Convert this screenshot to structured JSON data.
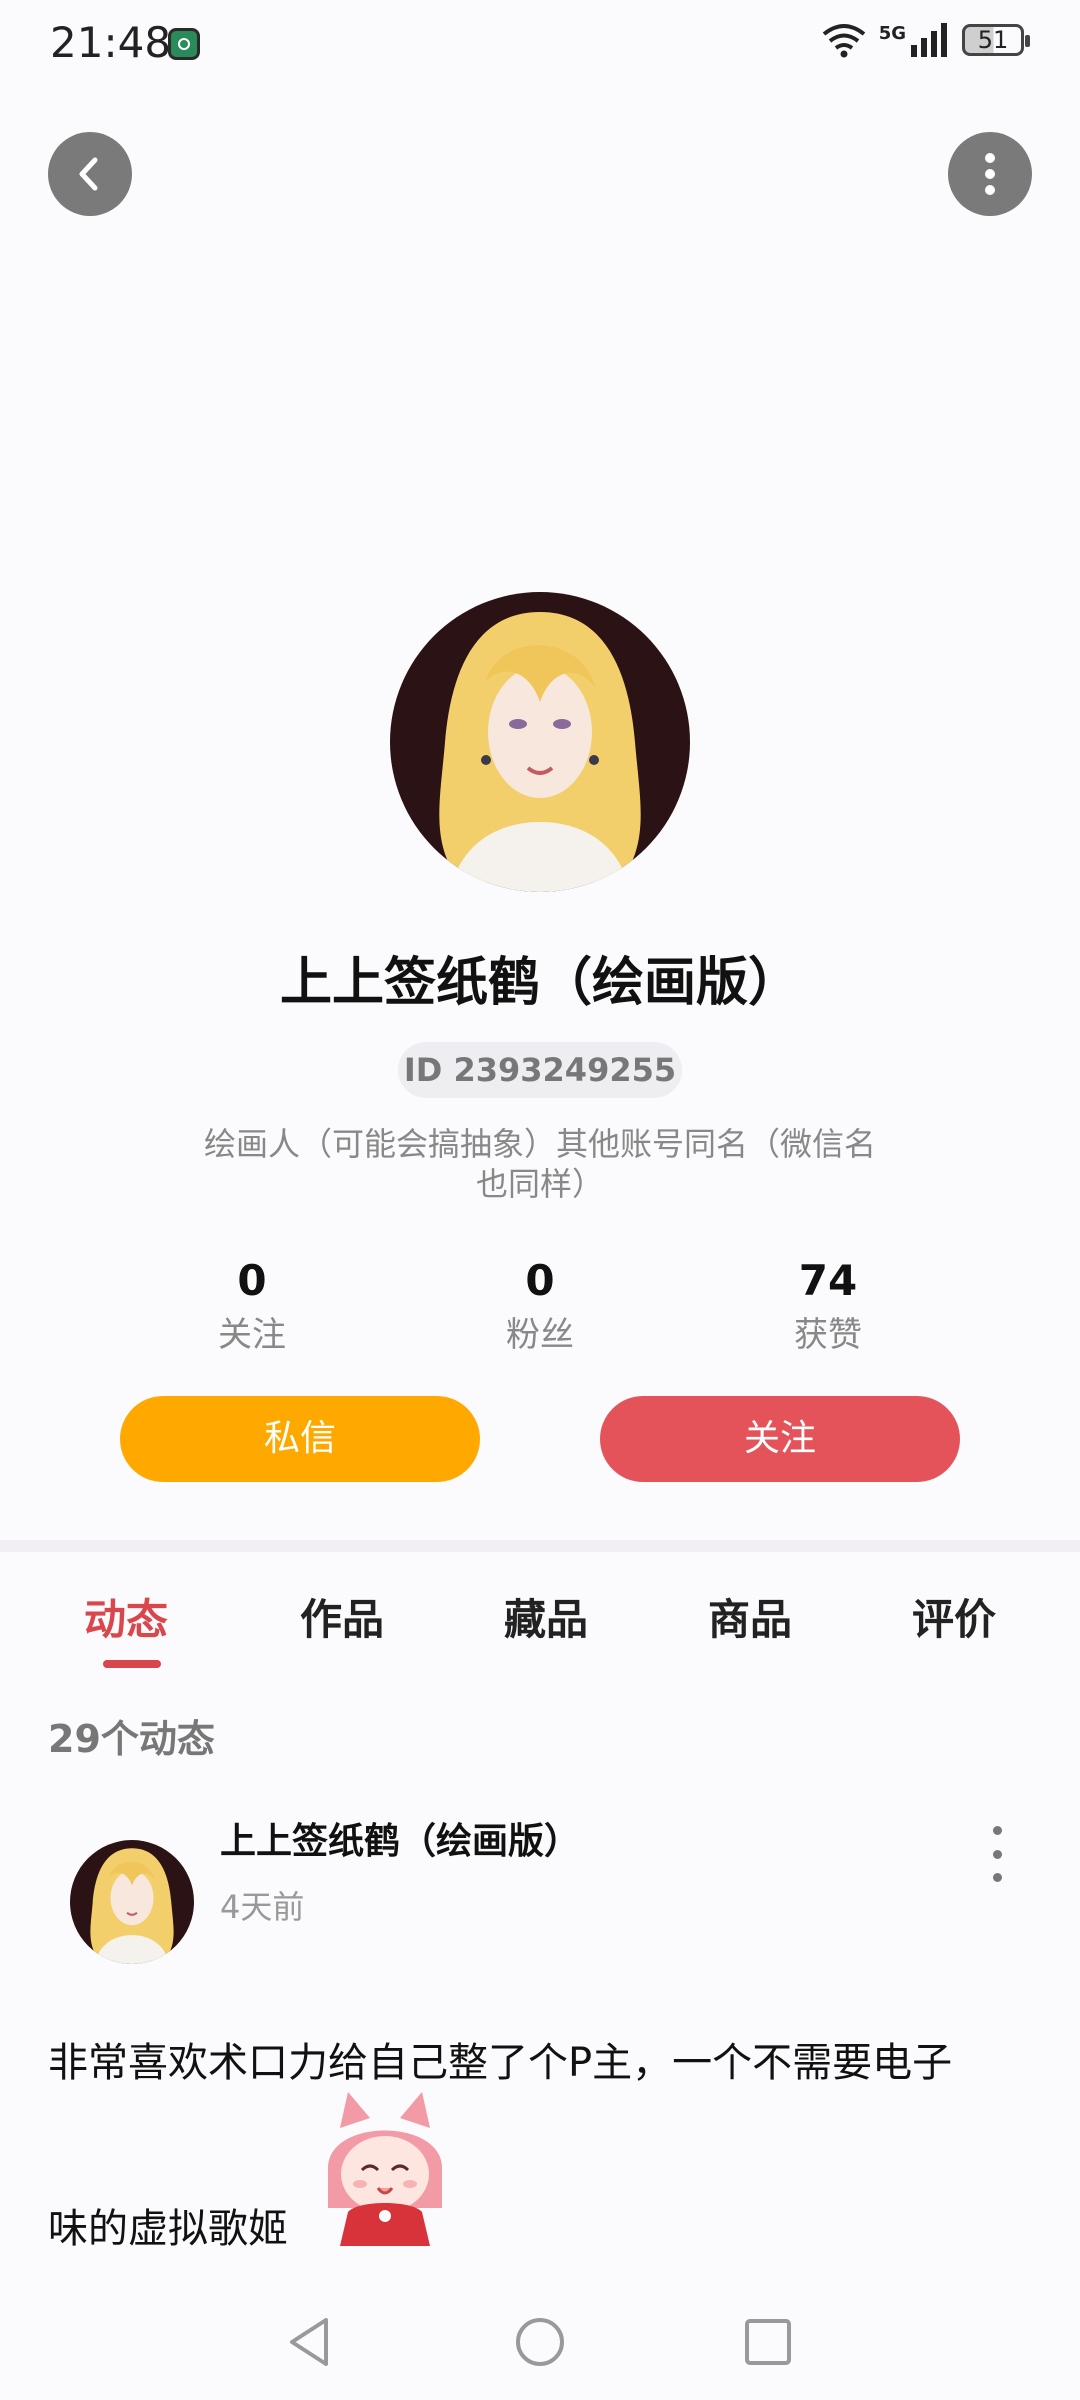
{
  "status_bar": {
    "time": "21:48",
    "network": "5G",
    "battery": "51"
  },
  "profile": {
    "name": "上上签纸鹤（绘画版）",
    "id_label": "ID 2393249255",
    "bio_line1": "绘画人（可能会搞抽象）其他账号同名（微信名",
    "bio_line2": "也同样）",
    "stats": [
      {
        "value": "0",
        "label": "关注"
      },
      {
        "value": "0",
        "label": "粉丝"
      },
      {
        "value": "74",
        "label": "获赞"
      }
    ],
    "message_label": "私信",
    "follow_label": "关注"
  },
  "tabs": [
    {
      "label": "动态",
      "active": true
    },
    {
      "label": "作品",
      "active": false
    },
    {
      "label": "藏品",
      "active": false
    },
    {
      "label": "商品",
      "active": false
    },
    {
      "label": "评价",
      "active": false
    }
  ],
  "feed": {
    "count_label": "29个动态",
    "post": {
      "author": "上上签纸鹤（绘画版）",
      "time": "4天前",
      "text_line1": "非常喜欢术口力给自己整了个P主，一个不需要电子",
      "text_line2": "味的虚拟歌姬"
    }
  },
  "colors": {
    "accent": "#d9464b",
    "message_button": "#ffa900",
    "follow_button": "#e5535a"
  }
}
